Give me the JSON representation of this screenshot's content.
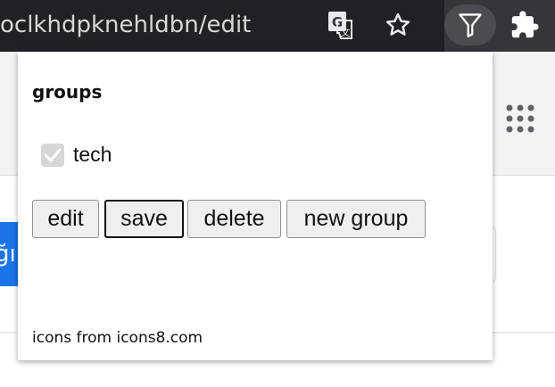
{
  "browser": {
    "url_text": "oclkhdpknehldbn/edit",
    "icons": {
      "translate": "translate-icon",
      "bookmark": "star-icon",
      "extension": "filter-icon",
      "extensions_menu": "puzzle-icon",
      "apps": "apps-grid-icon"
    },
    "colors": {
      "toolbar": "#35363a",
      "omnibox": "#202124",
      "accent_blue": "#1a73e8"
    }
  },
  "page": {
    "blue_button_fragment": "ğı"
  },
  "popup": {
    "title": "groups",
    "groups": [
      {
        "label": "tech",
        "checked": true
      }
    ],
    "buttons": {
      "edit": "edit",
      "save": "save",
      "delete": "delete",
      "new_group": "new group"
    },
    "footer": "icons from icons8.com"
  }
}
